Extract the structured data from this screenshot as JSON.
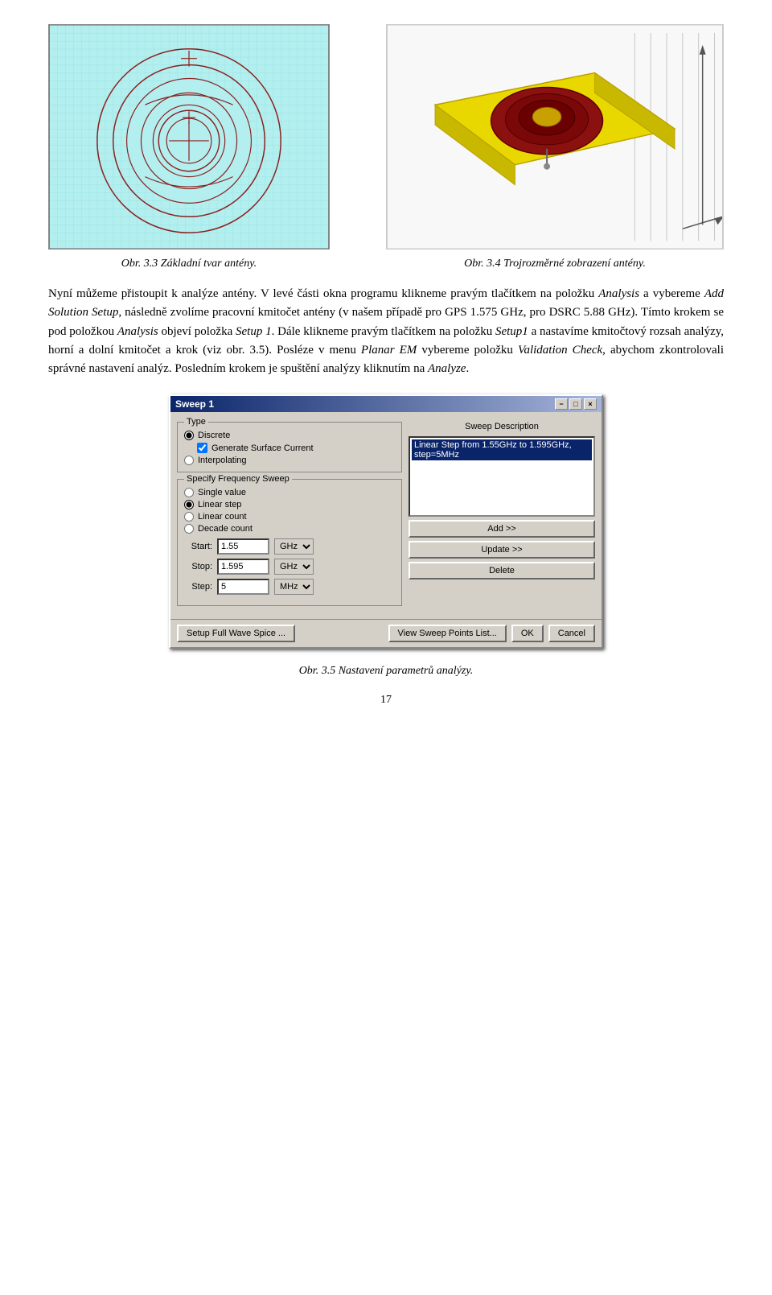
{
  "images": {
    "left_caption": "Obr. 3.3 Základní tvar antény.",
    "right_caption": "Obr. 3.4 Trojrozměrné zobrazení antény."
  },
  "body_paragraphs": [
    "Nyní můžeme přistoupit k analýze antény. V levé části okna programu klikneme pravým tlačítkem na položku Analysis a vybereme Add Solution Setup, následně zvolíme pracovní kmitočet antény (v našem případě pro GPS 1.575 GHz, pro DSRC 5.88 GHz). Tímto krokem se pod položkou Analysis objeví položka Setup 1. Dále klikneme pravým tlačítkem na položku Setup1 a nastavíme kmitočtový rozsah analýzy, horní a dolní kmitočet a krok (viz obr. 3.5). Posléze v menu Planar EM vybereme položku Validation Check, abychom zkontrolovali správné nastavení analýz. Posledním krokem je spuštění analýzy kliknutím na Analyze."
  ],
  "dialog": {
    "title": "Sweep 1",
    "close_btn": "×",
    "minimize_btn": "−",
    "maximize_btn": "□",
    "type_section_label": "Type",
    "type_options": [
      {
        "id": "discrete",
        "label": "Discrete",
        "selected": true
      },
      {
        "id": "interpolating",
        "label": "Interpolating",
        "selected": false
      }
    ],
    "generate_surface_current": {
      "label": "Generate Surface Current",
      "checked": true
    },
    "sweep_description_label": "Sweep Description",
    "sweep_description_item": "Linear Step from 1.55GHz to 1.595GHz, step=5MHz",
    "freq_sweep_section_label": "Specify Frequency Sweep",
    "freq_options": [
      {
        "id": "single",
        "label": "Single value",
        "selected": false
      },
      {
        "id": "linear_step",
        "label": "Linear step",
        "selected": true
      },
      {
        "id": "linear_count",
        "label": "Linear count",
        "selected": false
      },
      {
        "id": "decade_count",
        "label": "Decade count",
        "selected": false
      }
    ],
    "fields": [
      {
        "label": "Start:",
        "value": "1.55",
        "unit": "GHz"
      },
      {
        "label": "Stop:",
        "value": "1.595",
        "unit": "GHz"
      },
      {
        "label": "Step:",
        "value": "5",
        "unit": "MHz"
      }
    ],
    "add_btn": "Add >>",
    "update_btn": "Update >>",
    "delete_btn": "Delete",
    "setup_full_wave_btn": "Setup Full Wave Spice ...",
    "view_sweep_btn": "View Sweep Points List...",
    "ok_btn": "OK",
    "cancel_btn": "Cancel"
  },
  "fig_caption": "Obr. 3.5 Nastavení parametrů analýzy.",
  "page_number": "17"
}
